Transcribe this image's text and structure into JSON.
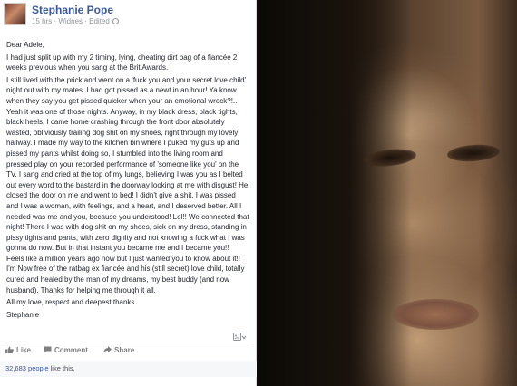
{
  "post": {
    "author": "Stephanie Pope",
    "meta": "15 hrs · Widnes · Edited",
    "paragraphs": [
      {
        "lines": [
          "Dear Adele,"
        ]
      },
      {
        "lines": [
          "I had just split up with my 2 timing, lying, cheating dirt bag of a fiancée 2",
          "weeks previous when you sang at the Brit Awards."
        ]
      },
      {
        "lines": [
          "I still lived with the prick and went on a 'fuck you and your secret love child'",
          "night out with my mates. I had got pissed as a newt in an hour! Ya know",
          "when they say you get pissed quicker when your an emotional wreck?!..",
          "Yeah it was one of those nights. Anyway, in my black dress, black tights,",
          "black heels, I came home crashing through the front door absolutely",
          "wasted, obliviously trailing dog shit on my shoes, right through my lovely",
          "hallway. I made my way to the kitchen bin where I puked my guts up and",
          "pissed my pants whilst doing so, I stumbled into the living room and",
          "pressed play on your recorded performance of 'someone like you' on the",
          "TV. I sang and cried at the top of my lungs, believing I was you as I belted",
          "out every word to the bastard in the doorway looking at me with disgust! He",
          "closed the door on me and went to bed! I didn't give a shit, I was pissed",
          "and I was a woman, with feelings, and a heart, and I deserved better. All I",
          "needed was me and you, because you understood! Lol!! We connected that",
          "night! There I was with dog shit on my shoes, sick on my dress, standing in",
          "pissy tights and pants, with zero dignity and not knowing a fuck what I was",
          "gonna do now. But in that instant you became me and I became you!!",
          "Feels like a million years ago now but I just wanted you to know about it!!",
          "I'm Now free of the ratbag ex fiancée and his (still secret) love child, totally",
          "cured and healed by the man of my dreams, my best buddy (and now",
          "husband). Thanks for helping me through it all."
        ]
      },
      {
        "lines": [
          "All my love, respect and deepest thanks."
        ]
      },
      {
        "lines": [
          "Stephanie"
        ]
      }
    ],
    "actions": {
      "like": "Like",
      "comment": "Comment",
      "share": "Share"
    },
    "likes_count": "32,683 people",
    "likes_suffix": " like this."
  },
  "icons": {
    "globe": "globe-icon",
    "chevron": "chevron-down-icon",
    "like": "thumbs-up-icon",
    "comment": "comment-icon",
    "share": "share-icon"
  },
  "colors": {
    "link_blue": "#3b5998",
    "muted": "#90949c",
    "text": "#1d2129"
  }
}
